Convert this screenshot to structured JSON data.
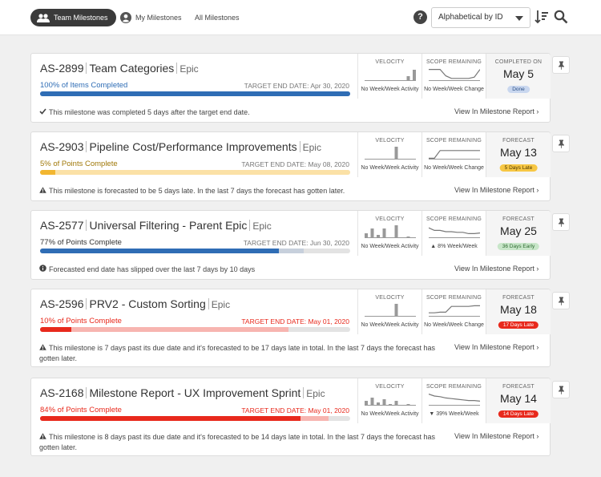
{
  "nav": {
    "tabs": [
      "Team Milestones",
      "My Milestones",
      "All Milestones"
    ],
    "help": "?",
    "sort": "Alphabetical by ID"
  },
  "cards": [
    {
      "id": "AS-2899",
      "name": "Team Categories",
      "type": "Epic",
      "progress_label": "100% of Items Completed",
      "target": "TARGET END DATE: Apr 30, 2020",
      "message": "This milestone was completed 5 days after the target end date.",
      "message_icon": "check-icon",
      "report": "View In Milestone Report",
      "velocity_label": "VELOCITY",
      "velocity_sub": "No Week/Week Activity",
      "scope_label": "SCOPE REMAINING",
      "scope_sub": "No Week/Week Change",
      "forecast_label": "COMPLETED ON",
      "date": "May 5",
      "badge": "Done",
      "progress": 1.0,
      "progress2": 1.0,
      "color_main": "#2f6db5",
      "color_light": "#a9c6e8",
      "pct_color": "#2f6db5",
      "target_color": "#777",
      "badge_bg": "#c9d7ef",
      "badge_fg": "#2a4f85",
      "velocity": [
        0,
        0,
        0,
        0,
        0,
        0,
        0,
        3,
        7
      ],
      "scope": [
        0.9,
        0.9,
        0.9,
        0.4,
        0.2,
        0.2,
        0.2,
        0.2,
        0.3,
        0.9
      ]
    },
    {
      "id": "AS-2903",
      "name": "Pipeline Cost/Performance Improvements",
      "type": "Epic",
      "progress_label": "5% of Points Complete",
      "target": "TARGET END DATE: May 08, 2020",
      "message": "This milestone is forecasted to be 5 days late. In the last 7 days the forecast has gotten later.",
      "message_icon": "warning-icon",
      "report": "View In Milestone Report",
      "velocity_label": "VELOCITY",
      "velocity_sub": "No Week/Week Activity",
      "scope_label": "SCOPE REMAINING",
      "scope_sub": "No Week/Week Change",
      "forecast_label": "FORECAST",
      "date": "May 13",
      "badge": "5 Days Late",
      "progress": 0.05,
      "progress2": 1.0,
      "color_main": "#f2b630",
      "color_light": "#fbe1a6",
      "pct_color": "#a07808",
      "target_color": "#777",
      "badge_bg": "#f7c744",
      "badge_fg": "#4a3600",
      "velocity": [
        0,
        0,
        0,
        0,
        0,
        8,
        0,
        0,
        0
      ],
      "scope": [
        0.1,
        0.1,
        0.7,
        0.7,
        0.7,
        0.7,
        0.7,
        0.7,
        0.7,
        0.7
      ]
    },
    {
      "id": "AS-2577",
      "name": "Universal Filtering - Parent Epic",
      "type": "Epic",
      "progress_label": "77% of Points Complete",
      "target": "TARGET END DATE: Jun 30, 2020",
      "message": "Forecasted end date has slipped over the last 7 days by 10 days",
      "message_icon": "info-icon",
      "report": "View In Milestone Report",
      "velocity_label": "VELOCITY",
      "velocity_sub": "No Week/Week Activity",
      "scope_label": "SCOPE REMAINING",
      "scope_sub": "8% Week/Week",
      "forecast_label": "FORECAST",
      "date": "May 25",
      "badge": "36 Days Early",
      "progress": 0.77,
      "progress2": 0.85,
      "color_main": "#2f6db5",
      "color_light": "#c7d0dc",
      "pct_color": "#333",
      "target_color": "#777",
      "badge_bg": "#c8e6c9",
      "badge_fg": "#2e6b31",
      "velocity": [
        3,
        6,
        2,
        6,
        0,
        8,
        0,
        1,
        0
      ],
      "scope": [
        0.8,
        0.6,
        0.6,
        0.5,
        0.5,
        0.45,
        0.45,
        0.35,
        0.35,
        0.4
      ]
    },
    {
      "id": "AS-2596",
      "name": "PRV2 - Custom Sorting",
      "type": "Epic",
      "progress_label": "10% of Points Complete",
      "target": "TARGET END DATE: May 01, 2020",
      "message": "This milestone is 7 days past its due date and it's forecasted to be 17 days late in total. In the last 7 days the forecast has gotten later.",
      "message_icon": "warning-icon",
      "report": "View In Milestone Report",
      "velocity_label": "VELOCITY",
      "velocity_sub": "No Week/Week Activity",
      "scope_label": "SCOPE REMAINING",
      "scope_sub": "No Week/Week Change",
      "forecast_label": "FORECAST",
      "date": "May 18",
      "badge": "17 Days Late",
      "progress": 0.1,
      "progress2": 0.8,
      "color_main": "#e8291c",
      "color_light": "#f7b5b0",
      "pct_color": "#e8291c",
      "target_color": "#e8291c",
      "badge_bg": "#e8291c",
      "badge_fg": "#ffffff",
      "velocity": [
        0,
        0,
        0,
        0,
        0,
        8,
        0,
        0,
        0
      ],
      "scope": [
        0.3,
        0.3,
        0.35,
        0.35,
        0.8,
        0.8,
        0.8,
        0.8,
        0.85,
        0.85
      ]
    },
    {
      "id": "AS-2168",
      "name": "Milestone Report - UX Improvement Sprint",
      "type": "Epic",
      "progress_label": "84% of Points Complete",
      "target": "TARGET END DATE: May 01, 2020",
      "message": "This milestone is 8 days past its due date and it's forecasted to be 14 days late in total. In the last 7 days the forecast has gotten later.",
      "message_icon": "warning-icon",
      "report": "View In Milestone Report",
      "velocity_label": "VELOCITY",
      "velocity_sub": "No Week/Week Activity",
      "scope_label": "SCOPE REMAINING",
      "scope_sub": "39% Week/Week",
      "forecast_label": "FORECAST",
      "date": "May 14",
      "badge": "14 Days Late",
      "progress": 0.84,
      "progress2": 0.93,
      "color_main": "#e8291c",
      "color_light": "#f7b5b0",
      "pct_color": "#e8291c",
      "target_color": "#e8291c",
      "badge_bg": "#e8291c",
      "badge_fg": "#ffffff",
      "velocity": [
        3,
        5,
        2,
        4,
        1,
        3,
        0,
        1,
        0
      ],
      "scope": [
        0.9,
        0.75,
        0.7,
        0.6,
        0.55,
        0.5,
        0.45,
        0.4,
        0.4,
        0.35
      ]
    }
  ]
}
